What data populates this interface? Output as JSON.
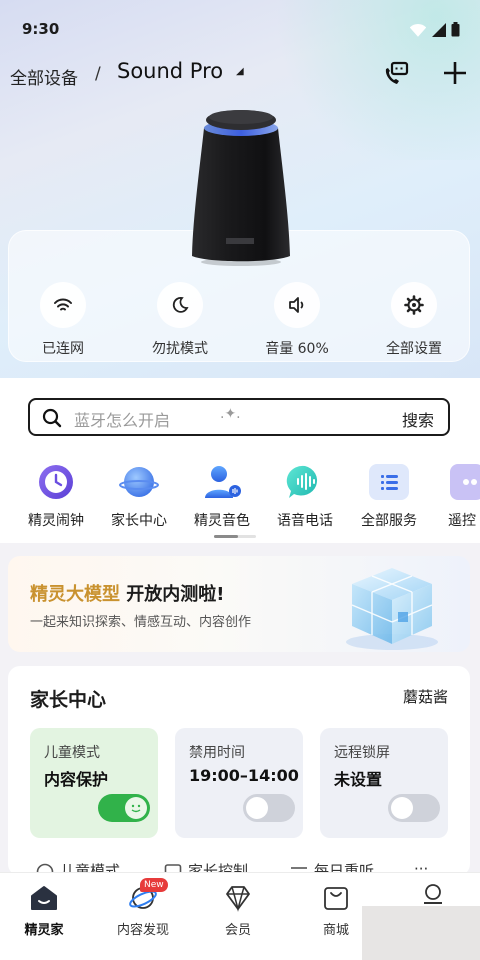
{
  "status": {
    "time": "9:30"
  },
  "header": {
    "breadcrumb_all": "全部设备",
    "separator": "/",
    "device_name": "Sound Pro",
    "caret": "◢"
  },
  "quick_controls": [
    {
      "label": "已连网",
      "icon": "wifi-icon"
    },
    {
      "label": "勿扰模式",
      "icon": "moon-icon"
    },
    {
      "label": "音量 60%",
      "icon": "volume-icon"
    },
    {
      "label": "全部设置",
      "icon": "gear-icon"
    }
  ],
  "search": {
    "placeholder": "蓝牙怎么开启",
    "sparkle": ".✦.",
    "button": "搜索"
  },
  "services": [
    {
      "label": "精灵闹钟",
      "icon": "alarm-icon"
    },
    {
      "label": "家长中心",
      "icon": "planet-icon"
    },
    {
      "label": "精灵音色",
      "icon": "voice-person-icon"
    },
    {
      "label": "语音电话",
      "icon": "voice-call-icon"
    },
    {
      "label": "全部服务",
      "icon": "list-icon"
    },
    {
      "label": "遥控",
      "icon": "remote-icon"
    }
  ],
  "banner": {
    "title_highlight": "精灵大模型",
    "title_rest": " 开放内测啦!",
    "subtitle": "一起来知识探索、情感互动、内容创作"
  },
  "parent_center": {
    "title": "家长中心",
    "child_name": "蘑菇酱",
    "cards": [
      {
        "label": "儿童模式",
        "value": "内容保护",
        "toggle_on": true
      },
      {
        "label": "禁用时间",
        "value": "19:00–14:00",
        "toggle_on": false
      },
      {
        "label": "远程锁屏",
        "value": "未设置",
        "toggle_on": false
      }
    ],
    "features": [
      {
        "label": "儿童模式",
        "icon": "clock-icon"
      },
      {
        "label": "家长控制",
        "icon": "calendar-icon"
      },
      {
        "label": "每日重听",
        "icon": "list-filter-icon"
      },
      {
        "label": "···",
        "icon": "more-icon"
      }
    ]
  },
  "tabbar": {
    "tabs": [
      {
        "label": "精灵家",
        "icon": "home-icon",
        "active": true
      },
      {
        "label": "内容发现",
        "icon": "discover-planet-icon",
        "active": false
      },
      {
        "label": "会员",
        "icon": "diamond-icon",
        "active": false
      },
      {
        "label": "商城",
        "icon": "shopping-bag-icon",
        "active": false
      },
      {
        "label": "",
        "icon": "profile-icon",
        "active": false
      }
    ],
    "new_badge": "New"
  },
  "colors": {
    "accent_gold": "#c9922f",
    "toggle_on": "#31b24a",
    "badge_red": "#e73b3b"
  }
}
